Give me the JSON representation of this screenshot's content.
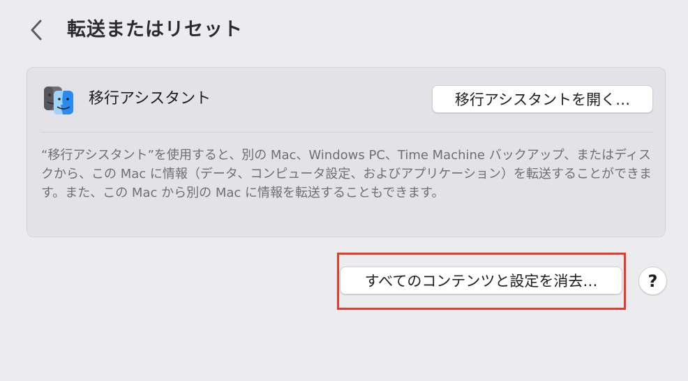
{
  "header": {
    "back_icon": "chevron-left-icon",
    "title": "転送またはリセット"
  },
  "migration": {
    "app_icon": "migration-assistant-icon",
    "app_name": "移行アシスタント",
    "open_button_label": "移行アシスタントを開く…",
    "description": "“移行アシスタント”を使用すると、別の Mac、Windows PC、Time Machine バックアップ、またはディスクから、この Mac に情報（データ、コンピュータ設定、およびアプリケーション）を転送することができます。また、この Mac から別の Mac に情報を転送することもできます。"
  },
  "actions": {
    "erase_button_label": "すべてのコンテンツと設定を消去…",
    "help_button_label": "?",
    "highlight_color": "#e53a2c"
  },
  "colors": {
    "background": "#ecebee",
    "card": "#e3e2e6",
    "finder_blue": "#2a8af0",
    "finder_gray": "#6d6f76"
  }
}
